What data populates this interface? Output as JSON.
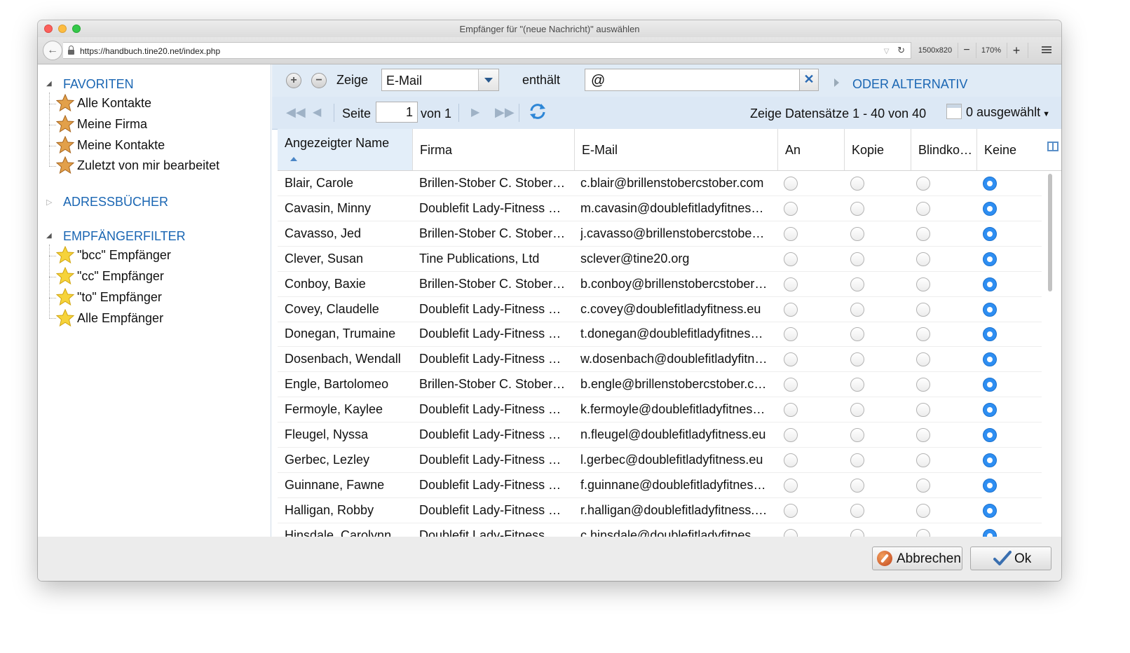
{
  "window": {
    "title": "Empfänger für \"(neue Nachricht)\" auswählen"
  },
  "browser": {
    "url": "https://handbuch.tine20.net/index.php",
    "resolution": "1500x820",
    "zoom": "170%",
    "zoom_out": "−",
    "zoom_in": "+"
  },
  "sidebar": {
    "favoriten": {
      "title": "FAVORITEN",
      "items": [
        "Alle Kontakte",
        "Meine Firma",
        "Meine Kontakte",
        "Zuletzt von mir bearbeitet"
      ]
    },
    "adressbuecher": {
      "title": "ADRESSBÜCHER"
    },
    "empfaengerfilter": {
      "title": "EMPFÄNGERFILTER",
      "items": [
        "\"bcc\" Empfänger",
        "\"cc\" Empfänger",
        "\"to\" Empfänger",
        "Alle Empfänger"
      ]
    }
  },
  "filter": {
    "zeige_label": "Zeige",
    "field_value": "E-Mail",
    "operator_label": "enthält",
    "value": "@",
    "oder_label": "ODER ALTERNATIV"
  },
  "paging": {
    "seite_label": "Seite",
    "page": "1",
    "von_label": "von 1",
    "status": "Zeige Datensätze 1 - 40 von 40",
    "selected": "0 ausgewählt"
  },
  "columns": {
    "name": "Angezeigter Name",
    "firma": "Firma",
    "email": "E-Mail",
    "an": "An",
    "kopie": "Kopie",
    "blind": "Blindko…",
    "keine": "Keine"
  },
  "rows": [
    {
      "name": "Blair, Carole",
      "firma": "Brillen-Stober C. Stober…",
      "email": "c.blair@brillenstobercstober.com",
      "selected": "keine"
    },
    {
      "name": "Cavasin, Minny",
      "firma": "Doublefit Lady-Fitness …",
      "email": "m.cavasin@doublefitladyfitnes…",
      "selected": "keine"
    },
    {
      "name": "Cavasso, Jed",
      "firma": "Brillen-Stober C. Stober…",
      "email": "j.cavasso@brillenstobercstobe…",
      "selected": "keine"
    },
    {
      "name": "Clever, Susan",
      "firma": "Tine Publications, Ltd",
      "email": "sclever@tine20.org",
      "selected": "keine"
    },
    {
      "name": "Conboy, Baxie",
      "firma": "Brillen-Stober C. Stober…",
      "email": "b.conboy@brillenstobercstober…",
      "selected": "keine"
    },
    {
      "name": "Covey, Claudelle",
      "firma": "Doublefit Lady-Fitness …",
      "email": "c.covey@doublefitladyfitness.eu",
      "selected": "keine"
    },
    {
      "name": "Donegan, Trumaine",
      "firma": "Doublefit Lady-Fitness …",
      "email": "t.donegan@doublefitladyfitnes…",
      "selected": "keine"
    },
    {
      "name": "Dosenbach, Wendall",
      "firma": "Doublefit Lady-Fitness …",
      "email": "w.dosenbach@doublefitladyfitn…",
      "selected": "keine"
    },
    {
      "name": "Engle, Bartolomeo",
      "firma": "Brillen-Stober C. Stober…",
      "email": "b.engle@brillenstobercstober.c…",
      "selected": "keine"
    },
    {
      "name": "Fermoyle, Kaylee",
      "firma": "Doublefit Lady-Fitness …",
      "email": "k.fermoyle@doublefitladyfitnes…",
      "selected": "keine"
    },
    {
      "name": "Fleugel, Nyssa",
      "firma": "Doublefit Lady-Fitness …",
      "email": "n.fleugel@doublefitladyfitness.eu",
      "selected": "keine"
    },
    {
      "name": "Gerbec, Lezley",
      "firma": "Doublefit Lady-Fitness …",
      "email": "l.gerbec@doublefitladyfitness.eu",
      "selected": "keine"
    },
    {
      "name": "Guinnane, Fawne",
      "firma": "Doublefit Lady-Fitness …",
      "email": "f.guinnane@doublefitladyfitnes…",
      "selected": "keine"
    },
    {
      "name": "Halligan, Robby",
      "firma": "Doublefit Lady-Fitness …",
      "email": "r.halligan@doublefitladyfitness.…",
      "selected": "keine"
    },
    {
      "name": "Hinsdale, Carolynn",
      "firma": "Doublefit Lady-Fitness …",
      "email": "c.hinsdale@doublefitladyfitnes…",
      "selected": "keine"
    }
  ],
  "buttons": {
    "cancel": "Abbrechen",
    "ok": "Ok"
  },
  "colors": {
    "link_blue": "#1a66b3",
    "toolbar_bg": "#e0ebf6",
    "radio_on": "#2e8ef2"
  }
}
